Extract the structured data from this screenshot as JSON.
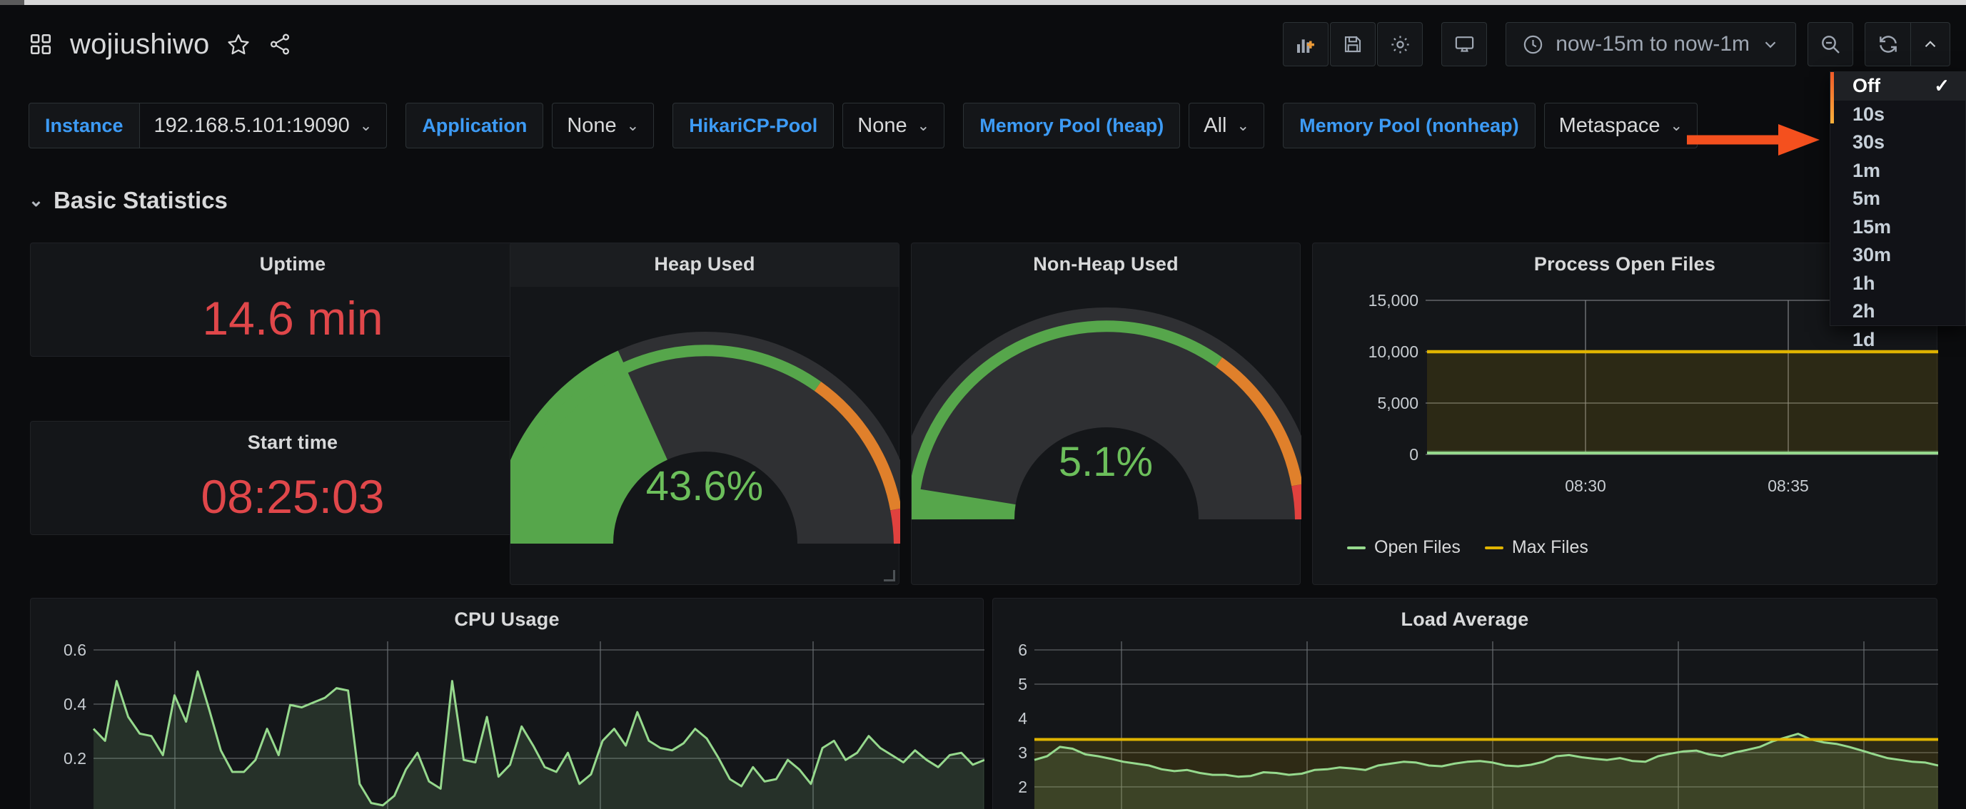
{
  "header": {
    "dashboard_title": "wojiushiwo",
    "icons": {
      "apps": "dashboard-grid-icon",
      "star": "star-icon",
      "share": "share-icon",
      "add_panel": "add-panel-icon",
      "save": "save-icon",
      "settings": "gear-icon",
      "tv": "tv-mode-icon",
      "zoom_out": "zoom-out-icon",
      "refresh": "refresh-icon",
      "caret_up": "chevron-up-icon"
    },
    "time_range": "now-15m to now-1m"
  },
  "refresh_menu": {
    "options": [
      {
        "label": "Off",
        "selected": true
      },
      {
        "label": "10s",
        "selected": false
      },
      {
        "label": "30s",
        "selected": false
      },
      {
        "label": "1m",
        "selected": false
      },
      {
        "label": "5m",
        "selected": false
      },
      {
        "label": "15m",
        "selected": false
      },
      {
        "label": "30m",
        "selected": false
      },
      {
        "label": "1h",
        "selected": false
      },
      {
        "label": "2h",
        "selected": false
      },
      {
        "label": "1d",
        "selected": false
      }
    ],
    "check_glyph": "✓"
  },
  "variables": [
    {
      "label": "Instance",
      "value": "192.168.5.101:19090"
    },
    {
      "label": "Application",
      "value": "None"
    },
    {
      "label": "HikariCP-Pool",
      "value": "None"
    },
    {
      "label": "Memory Pool (heap)",
      "value": "All"
    },
    {
      "label": "Memory Pool (nonheap)",
      "value": "Metaspace"
    }
  ],
  "row": {
    "title": "Basic Statistics",
    "collapsed": false
  },
  "panels": {
    "uptime": {
      "title": "Uptime",
      "value": "14.6 min"
    },
    "starttime": {
      "title": "Start time",
      "value": "08:25:03"
    },
    "heap": {
      "title": "Heap Used",
      "value": "43.6%",
      "percent": 43.6
    },
    "nonheap": {
      "title": "Non-Heap Used",
      "value": "5.1%",
      "percent": 5.1
    }
  },
  "colors": {
    "red": "#e0474a",
    "green": "#6cbf5b",
    "orange": "#e0802b",
    "threshold_red": "#e0413e",
    "series_green": "#96d98d",
    "series_yellow": "#e0b400",
    "link_blue": "#3d9bf5",
    "annotation_arrow": "#f4501e"
  },
  "chart_data": [
    {
      "type": "line",
      "title": "Process Open Files",
      "xlabel": "",
      "ylabel": "",
      "ylim": [
        0,
        15000
      ],
      "yticks": [
        0,
        5000,
        10000,
        15000
      ],
      "ytick_labels": [
        "0",
        "5,000",
        "10,000",
        "15,000"
      ],
      "xtick_labels": [
        "08:30",
        "08:35"
      ],
      "grid": true,
      "legend_position": "bottom",
      "series": [
        {
          "name": "Open Files",
          "color": "#96d98d",
          "constant": 100,
          "values": [
            100,
            100,
            100,
            100,
            100,
            100,
            100,
            100,
            100,
            100
          ]
        },
        {
          "name": "Max Files",
          "color": "#e0b400",
          "constant": 10000,
          "values": [
            10000,
            10000,
            10000,
            10000,
            10000,
            10000,
            10000,
            10000,
            10000,
            10000
          ]
        }
      ]
    },
    {
      "type": "area",
      "title": "CPU Usage",
      "xlabel": "",
      "ylabel": "",
      "ylim": [
        0,
        0.68
      ],
      "yticks": [
        0.2,
        0.4,
        0.6
      ],
      "ytick_labels": [
        "0.2",
        "0.4",
        "0.6"
      ],
      "grid": true,
      "legend_position": "none",
      "series": [
        {
          "name": "CPU Usage",
          "color": "#96d98d",
          "values": [
            0.35,
            0.3,
            0.55,
            0.4,
            0.33,
            0.32,
            0.24,
            0.49,
            0.38,
            0.59,
            0.43,
            0.26,
            0.17,
            0.17,
            0.22,
            0.35,
            0.24,
            0.45,
            0.44,
            0.46,
            0.48,
            0.52,
            0.51,
            0.12,
            0.04,
            0.03,
            0.07,
            0.18,
            0.25,
            0.13,
            0.1,
            0.55,
            0.22,
            0.21,
            0.4,
            0.15,
            0.2,
            0.36,
            0.28,
            0.19,
            0.17,
            0.25,
            0.12,
            0.16,
            0.3,
            0.35,
            0.28,
            0.42,
            0.3,
            0.27,
            0.26,
            0.29,
            0.35,
            0.31,
            0.23,
            0.14,
            0.11,
            0.19,
            0.13,
            0.14,
            0.22,
            0.18,
            0.12,
            0.27,
            0.3,
            0.22,
            0.25,
            0.32,
            0.27,
            0.24,
            0.21,
            0.26,
            0.22,
            0.19,
            0.24,
            0.25,
            0.2,
            0.22
          ]
        }
      ]
    },
    {
      "type": "area",
      "title": "Load Average",
      "xlabel": "",
      "ylabel": "",
      "ylim": [
        2,
        6.4
      ],
      "yticks": [
        2,
        3,
        4,
        5,
        6
      ],
      "ytick_labels": [
        "2",
        "3",
        "4",
        "5",
        "6"
      ],
      "grid": true,
      "legend_position": "none",
      "series": [
        {
          "name": "Load Average",
          "color": "#96d98d",
          "values": [
            3.45,
            3.55,
            3.8,
            3.75,
            3.6,
            3.55,
            3.48,
            3.4,
            3.35,
            3.3,
            3.2,
            3.15,
            3.18,
            3.1,
            3.05,
            3.05,
            3.0,
            3.02,
            3.12,
            3.1,
            3.05,
            3.08,
            3.18,
            3.2,
            3.25,
            3.22,
            3.18,
            3.3,
            3.35,
            3.4,
            3.38,
            3.3,
            3.28,
            3.35,
            3.4,
            3.42,
            3.38,
            3.3,
            3.28,
            3.32,
            3.4,
            3.55,
            3.58,
            3.52,
            3.48,
            3.45,
            3.5,
            3.42,
            3.4,
            3.55,
            3.62,
            3.68,
            3.7,
            3.6,
            3.55,
            3.65,
            3.72,
            3.8,
            3.95,
            4.05,
            4.15,
            4.0,
            3.92,
            3.88,
            3.8,
            3.7,
            3.6,
            3.5,
            3.45,
            3.4,
            3.38,
            3.3
          ]
        },
        {
          "name": "Threshold",
          "color": "#e0b400",
          "constant": 4.0,
          "values": [
            4,
            4,
            4,
            4,
            4,
            4,
            4,
            4,
            4,
            4
          ]
        }
      ]
    }
  ]
}
